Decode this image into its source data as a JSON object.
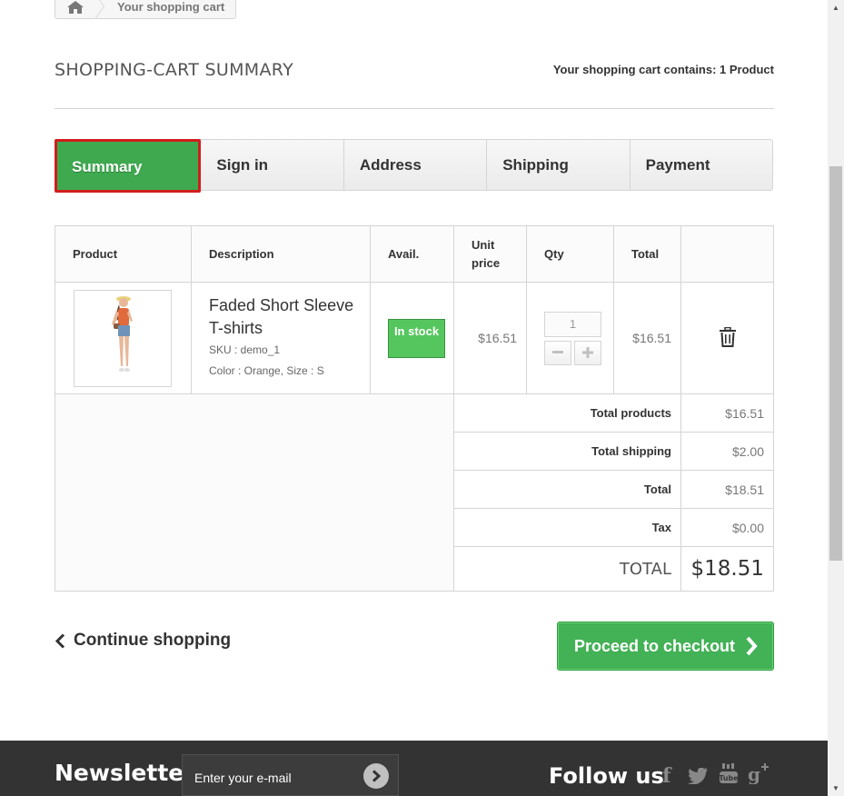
{
  "breadcrumb": {
    "home_icon": "home-icon",
    "current": "Your shopping cart"
  },
  "page_heading": "SHOPPING-CART SUMMARY",
  "cart_counter": "Your shopping cart contains: 1 Product",
  "steps": [
    {
      "label": "Summary",
      "active": true
    },
    {
      "label": "Sign in"
    },
    {
      "label": "Address"
    },
    {
      "label": "Shipping"
    },
    {
      "label": "Payment"
    }
  ],
  "table": {
    "headers": {
      "product": "Product",
      "description": "Description",
      "avail": "Avail.",
      "unit_price": "Unit price",
      "qty": "Qty",
      "total": "Total"
    },
    "item": {
      "name": "Faded Short Sleeve T-shirts",
      "sku": "SKU : demo_1",
      "attributes": "Color : Orange, Size : S",
      "availability": "In stock",
      "unit_price": "$16.51",
      "quantity": "1",
      "total": "$16.51",
      "delete_icon": "trash-icon"
    },
    "summary": [
      {
        "label": "Total products",
        "value": "$16.51"
      },
      {
        "label": "Total shipping",
        "value": "$2.00"
      },
      {
        "label": "Total",
        "value": "$18.51"
      },
      {
        "label": "Tax",
        "value": "$0.00"
      }
    ],
    "grand_total": {
      "label": "TOTAL",
      "value": "$18.51"
    }
  },
  "actions": {
    "continue": "Continue shopping",
    "checkout": "Proceed to checkout"
  },
  "footer": {
    "newsletter_title": "Newsletter",
    "newsletter_placeholder": "Enter your e-mail",
    "follow_title": "Follow us",
    "social": [
      "facebook-icon",
      "twitter-icon",
      "youtube-icon",
      "google-plus-icon"
    ]
  },
  "colors": {
    "accent_green": "#43b155",
    "active_border": "#d11d1d",
    "footer_bg": "#333333"
  }
}
